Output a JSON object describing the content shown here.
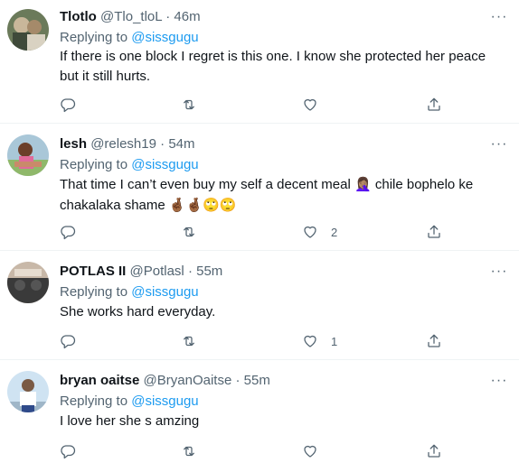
{
  "tweets": [
    {
      "name": "Tlotlo",
      "handle": "@Tlo_tloL",
      "time": "46m",
      "reply_prefix": "Replying to",
      "reply_to": "@sissgugu",
      "text": "If there is one block I regret is this one. I know she protected her peace but it still hurts.",
      "likes": ""
    },
    {
      "name": "lesh",
      "handle": "@relesh19",
      "time": "54m",
      "reply_prefix": "Replying to",
      "reply_to": "@sissgugu",
      "text_line1": "That time I can’t even buy my self a decent meal",
      "emoji1": "🤦🏽‍♀️",
      "text_line1b": "chile bophelo ke",
      "text_line2": "chakalaka shame",
      "emoji2": "🤞🏾🤞🏾🙄🙄",
      "likes": "2"
    },
    {
      "name": "POTLAS II",
      "handle": "@Potlasl",
      "time": "55m",
      "reply_prefix": "Replying to",
      "reply_to": "@sissgugu",
      "text": "She works hard everyday.",
      "likes": "1"
    },
    {
      "name": "bryan oaitse",
      "handle": "@BryanOaitse",
      "time": "55m",
      "reply_prefix": "Replying to",
      "reply_to": "@sissgugu",
      "text": "I love her she s amzing",
      "likes": ""
    }
  ],
  "separator": "·",
  "more_glyph": "···",
  "icons": [
    "reply-icon",
    "retweet-icon",
    "like-icon",
    "share-icon",
    "more-icon"
  ],
  "colors": {
    "link": "#1d9bf0",
    "muted": "#536471",
    "text": "#0f1419",
    "border": "#eff3f4"
  }
}
